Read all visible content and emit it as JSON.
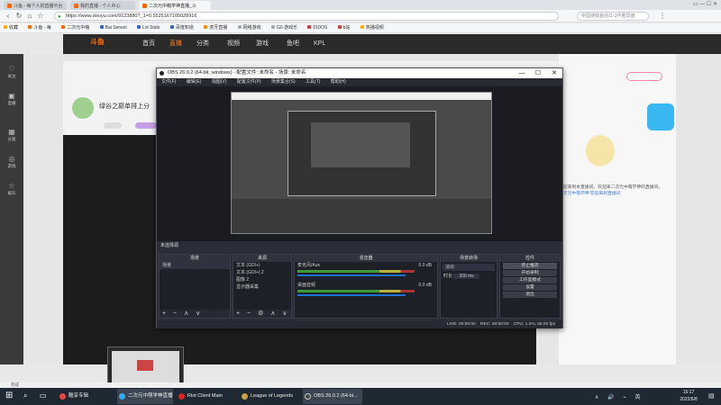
{
  "browser": {
    "tabs": [
      "斗鱼 - 每个人的直播平台",
      "我的直播 - 个人中心",
      "二次元中萌学神直播_斗"
    ],
    "url": "https://www.douyu.com/9123880?_1=0.55251671050289​16",
    "search_placeholder": "中国游戏首创11-3不胜早盘",
    "bookmarks": [
      "收藏",
      "斗鱼 - 每",
      "二次元中萌",
      "Bai Sensel",
      "Lol Stats",
      "百度知道",
      "虎牙直播",
      "网络游戏",
      "G0 游戏乐",
      "抖DOS",
      "b站",
      "热播视频"
    ]
  },
  "site": {
    "logo": "斗鱼",
    "nav": [
      "首页",
      "直播",
      "分类",
      "视频",
      "游戏",
      "鱼吧",
      "KPL"
    ],
    "room_title": "绿谷之巅单排上分",
    "rail": [
      "关注",
      "直播",
      "分类",
      "游戏",
      "娱乐"
    ],
    "chat_line": "欢迎来到本直播间，欢迎来二次元中萌学神的直播间。",
    "chat_tail": "二次元中萌学神 欢迎来到直播间"
  },
  "obs": {
    "title": "OBS 26.0.2 (64-bit, windows) - 配置文件: 未命名 - 场景: 未命名",
    "menu": [
      "文件(F)",
      "编辑(E)",
      "视图(V)",
      "配置文件(P)",
      "场景集合(S)",
      "工具(T)",
      "帮助(H)"
    ],
    "scene_label": "未选择源",
    "panels": {
      "scenes": {
        "title": "场景",
        "items": [
          "场景"
        ]
      },
      "sources": {
        "title": "来源",
        "items": [
          "文本 (GDI+)",
          "文本 (GDI+) 2",
          "图像 2",
          "显示器采集"
        ]
      },
      "mixer": {
        "title": "混音器",
        "tracks": [
          {
            "name": "麦克风/Aux",
            "db": "0.0 dB"
          },
          {
            "name": "桌面音频",
            "db": "0.0 dB"
          }
        ]
      },
      "transitions": {
        "title": "场景转场",
        "type": "淡出",
        "duration_label": "时长",
        "duration": "300 ms"
      },
      "controls": {
        "title": "控件",
        "buttons": [
          "停止推流",
          "开始录制",
          "工作室模式",
          "设置",
          "退出"
        ]
      }
    },
    "status": {
      "live": "LIVE: 00:00:00",
      "rec": "REC: 00:00:00",
      "cpu": "CPU: 1.2%, 60.00 fps"
    }
  },
  "statusbar": "完成",
  "taskbar": {
    "items": [
      "酷享专辑",
      "二次元中萌学神直播",
      "Riot Client Main",
      "League of Legends",
      "OBS 26.0.2 (64-bi..."
    ],
    "time": "15:17",
    "date": "2022/6/8"
  }
}
